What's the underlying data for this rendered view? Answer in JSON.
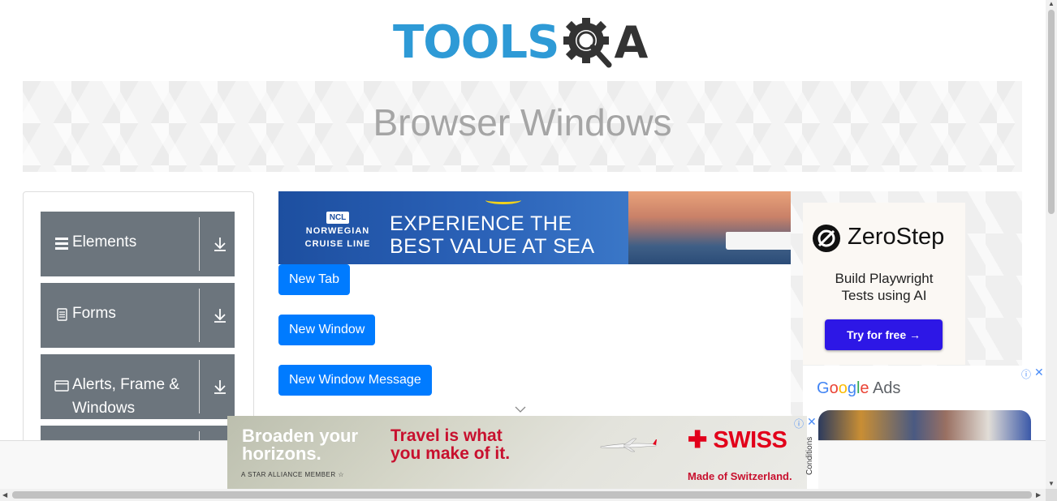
{
  "header": {
    "logo_tools": "TOOLS",
    "logo_a": "A"
  },
  "banner": {
    "title": "Browser Windows"
  },
  "sidebar": {
    "groups": [
      {
        "label": "Elements",
        "icon": "hamburger-icon"
      },
      {
        "label": "Forms",
        "icon": "form-document-icon"
      },
      {
        "label": "Alerts, Frame &",
        "label2": "Windows",
        "icon": "browser-window-icon"
      }
    ]
  },
  "main": {
    "ad_ncl": {
      "brand_badge": "NCL",
      "brand_line1": "NORWEGIAN",
      "brand_line2": "CRUISE LINE",
      "headline1": "EXPERIENCE THE",
      "headline2": "BEST VALUE AT SEA"
    },
    "buttons": {
      "new_tab": "New Tab",
      "new_window": "New Window",
      "new_window_message": "New Window Message"
    }
  },
  "ads_right": {
    "zerostep": {
      "name": "ZeroStep",
      "tagline1": "Build Playwright",
      "tagline2": "Tests using AI",
      "cta": "Try for free →"
    },
    "google_ads": {
      "g": "G",
      "o1": "o",
      "o2": "o",
      "g2": "g",
      "l": "l",
      "e": "e",
      "ads": " Ads",
      "info_glyph": "ⓘ",
      "close_glyph": "✕"
    }
  },
  "ad_bottom": {
    "left_line1": "Broaden your",
    "left_line2": "horizons.",
    "star_alliance": "A STAR ALLIANCE MEMBER ☆",
    "mid_line1": "Travel is what",
    "mid_line2": "you make of it.",
    "logo": "✚ SWISS",
    "made": "Made of Switzerland.",
    "info_glyph": "ⓘ",
    "close_glyph": "✕",
    "conditions": "Conditions"
  },
  "colors": {
    "primary_button": "#007bff",
    "sidebar_group": "#6c757d",
    "logo_blue": "#2e9ad6",
    "zerostep_button": "#2d17e6",
    "swiss_red": "#e2001a"
  }
}
